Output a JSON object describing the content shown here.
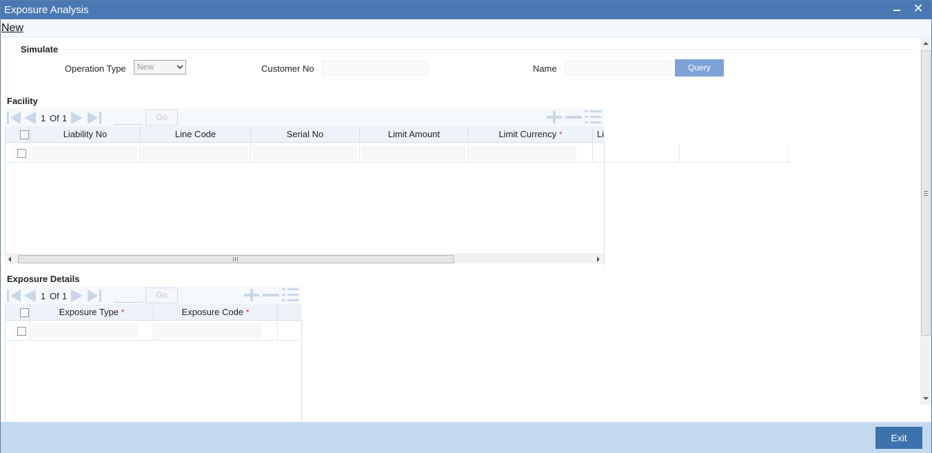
{
  "window": {
    "title": "Exposure Analysis"
  },
  "menu": {
    "new_label": "New"
  },
  "simulate": {
    "title": "Simulate",
    "operation_type_label": "Operation Type",
    "operation_type_value": "New",
    "customer_no_label": "Customer No",
    "customer_no_value": "",
    "name_label": "Name",
    "name_value": "",
    "query_label": "Query"
  },
  "facility": {
    "title": "Facility",
    "page_current": "1",
    "page_of": "Of",
    "page_total": "1",
    "go_label": "Go",
    "columns": [
      "Liability No",
      "Line Code",
      "Serial No",
      "Limit Amount",
      "Limit Currency",
      "Li"
    ],
    "required_mark": "*"
  },
  "exposure": {
    "title": "Exposure Details",
    "page_current": "1",
    "page_of": "Of",
    "page_total": "1",
    "go_label": "Go",
    "columns": [
      "Exposure Type",
      "Exposure Code"
    ],
    "required_mark": "*"
  },
  "footer": {
    "exit_label": "Exit"
  },
  "colors": {
    "titlebar": "#4a78b3",
    "query": "#7da3d6",
    "exit": "#3d72ac",
    "footer": "#c3d9ee",
    "required": "#d23a3a"
  },
  "icons": [
    "minimize-icon",
    "close-icon",
    "first-page-icon",
    "prev-page-icon",
    "next-page-icon",
    "last-page-icon",
    "add-row-icon",
    "delete-row-icon",
    "single-view-icon",
    "chevron-down-icon"
  ]
}
